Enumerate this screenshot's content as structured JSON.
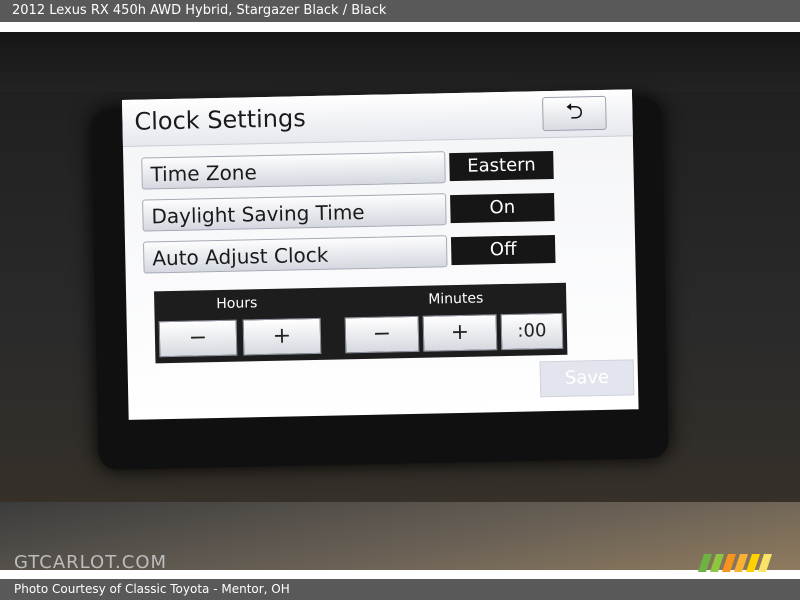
{
  "caption": {
    "top": "2012 Lexus RX 450h AWD Hybrid,  Stargazer Black / Black",
    "bottom": "Photo Courtesy of Classic Toyota - Mentor, OH"
  },
  "watermark": "GTCARLOT.COM",
  "screen": {
    "title": "Clock Settings",
    "back_icon": "return-arrow-icon",
    "back_glyph": "⮌",
    "rows": [
      {
        "label": "Time Zone",
        "value": "Eastern"
      },
      {
        "label": "Daylight Saving Time",
        "value": "On"
      },
      {
        "label": "Auto Adjust Clock",
        "value": "Off"
      }
    ],
    "clock": {
      "hours_label": "Hours",
      "minutes_label": "Minutes",
      "hours_minus": "−",
      "hours_plus": "+",
      "minutes_minus": "−",
      "minutes_plus": "+",
      "reset": ":00"
    },
    "save_label": "Save"
  },
  "colors": {
    "caption_bar": "#595959",
    "value_box": "#161616",
    "save_disabled": "#e3e5ee"
  }
}
